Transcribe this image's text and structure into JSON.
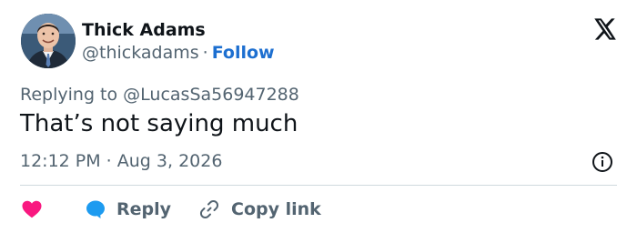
{
  "author": {
    "name": "Thick Adams",
    "handle": "@thickadams",
    "separator": "·",
    "follow_label": "Follow"
  },
  "tweet": {
    "replying_to": "Replying to @LucasSa56947288",
    "text": "That’s not saying much",
    "timestamp": "12:12 PM · Aug 3, 2026"
  },
  "actions": {
    "reply_label": "Reply",
    "copy_link_label": "Copy link"
  },
  "icons": {
    "logo": "x-logo-icon",
    "info": "info-icon",
    "like": "heart-icon",
    "reply": "speech-bubble-icon",
    "copy_link": "link-icon"
  },
  "colors": {
    "follow": "#1d6fd0",
    "heart": "#f91880",
    "reply_bubble": "#1d9bf0",
    "secondary_text": "#536471"
  }
}
